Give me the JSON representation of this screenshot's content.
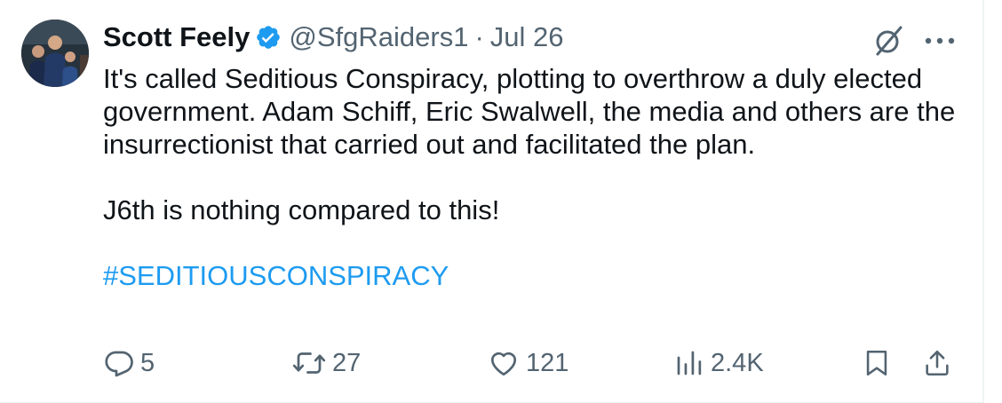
{
  "tweet": {
    "author": {
      "name": "Scott Feely",
      "handle": "@SfgRaiders1",
      "verified": true,
      "avatar_icon": "profile-photo"
    },
    "separator": "·",
    "date": "Jul 26",
    "body": {
      "line1": "It's called Seditious Conspiracy, plotting to overthrow a duly elected government. Adam Schiff, Eric Swalwell, the media and others are the insurrectionist that carried out and facilitated the plan.",
      "line2": "J6th is nothing compared to this!",
      "hashtag": "#SEDITIOUSCONSPIRACY"
    },
    "metrics": {
      "replies": "5",
      "retweets": "27",
      "likes": "121",
      "views": "2.4K"
    },
    "colors": {
      "text": "#0f1419",
      "secondary": "#536471",
      "accent": "#1d9bf0"
    },
    "icons": {
      "grok": "grok-icon",
      "more": "more-icon",
      "reply": "reply-icon",
      "retweet": "retweet-icon",
      "like": "like-icon",
      "views": "views-icon",
      "bookmark": "bookmark-icon",
      "share": "share-icon"
    }
  }
}
